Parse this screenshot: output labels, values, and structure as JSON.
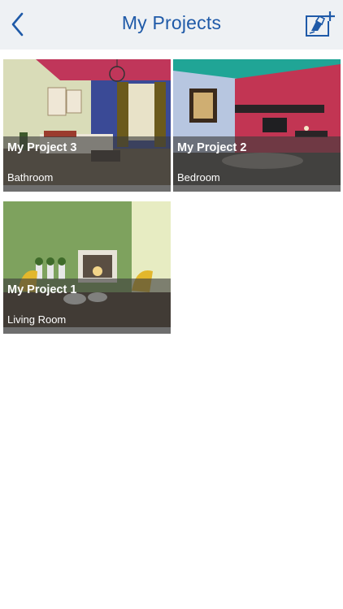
{
  "header": {
    "title": "My Projects",
    "back_icon": "chevron-left-icon",
    "add_icon": "add-project-icon"
  },
  "colors": {
    "header_bg": "#eef1f4",
    "accent": "#1f5aa8"
  },
  "projects": [
    {
      "name": "My Project 3",
      "room": "Bathroom"
    },
    {
      "name": "My Project 2",
      "room": "Bedroom"
    },
    {
      "name": "My Project 1",
      "room": "Living Room"
    }
  ]
}
